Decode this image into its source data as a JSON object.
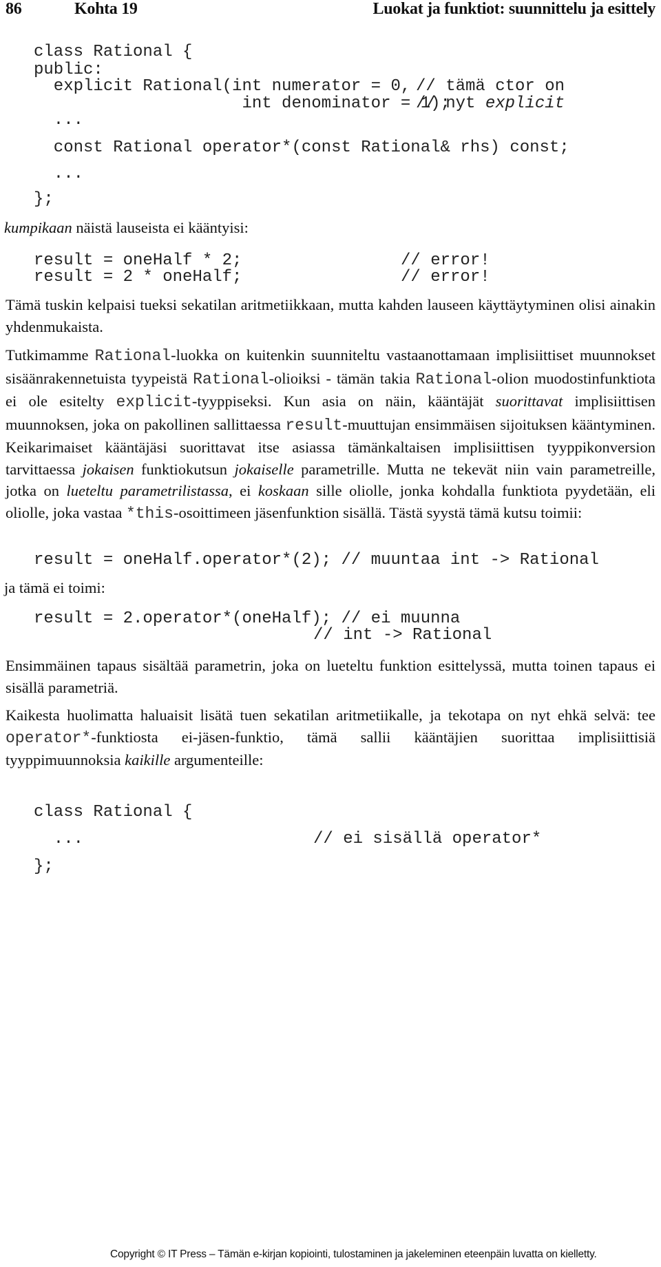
{
  "header": {
    "page_number": "86",
    "chapter": "Kohta 19",
    "section_title": "Luokat ja funktiot: suunnittelu ja esittely"
  },
  "code_block_1": {
    "lines": [
      "class Rational {",
      "public:",
      "  explicit Rational(int numerator = 0,",
      "                     int denominator = 1);",
      "  ...",
      "  const Rational operator*(const Rational& rhs) const;",
      "  ...",
      "};"
    ],
    "comment_1": "// tämä ctor on",
    "comment_2_prefix": "// nyt ",
    "comment_2_italic": "explicit"
  },
  "intro": {
    "italic": "kumpikaan",
    "rest": " näistä lauseista ei kääntyisi:"
  },
  "code_block_2": {
    "lines": [
      {
        "code": "result = oneHalf * 2;",
        "comment": "// error!"
      },
      {
        "code": "result = 2 * oneHalf;",
        "comment": "// error!"
      }
    ]
  },
  "paragraph_1": "Tämä tuskin kelpaisi tueksi sekatilan aritmetiikkaan, mutta kahden lauseen käyttäytyminen olisi ainakin yhdenmukaista.",
  "paragraph_2": {
    "segments": [
      {
        "t": "text",
        "v": "Tutkimamme "
      },
      {
        "t": "mono",
        "v": "Rational"
      },
      {
        "t": "text",
        "v": "-luokka on kuitenkin suunniteltu vastaanottamaan implisiittiset muunnokset sisäänrakennetuista tyypeistä "
      },
      {
        "t": "mono",
        "v": "Rational"
      },
      {
        "t": "text",
        "v": "-olioiksi - tämän takia "
      },
      {
        "t": "mono",
        "v": "Rational"
      },
      {
        "t": "text",
        "v": "-olion muodostinfunktiota ei ole esitelty "
      },
      {
        "t": "mono",
        "v": "explicit"
      },
      {
        "t": "text",
        "v": "-tyyppiseksi. Kun asia on näin, kääntäjät "
      },
      {
        "t": "italic",
        "v": "suorittavat"
      },
      {
        "t": "text",
        "v": " implisiittisen muunnoksen, joka on pakollinen sallittaessa "
      },
      {
        "t": "mono",
        "v": "result"
      },
      {
        "t": "text",
        "v": "-muuttujan ensimmäisen sijoituksen kääntyminen. Keikarimaiset kääntäjäsi suorittavat itse asiassa tämänkaltaisen implisiittisen tyyppikonversion tarvittaessa "
      },
      {
        "t": "italic",
        "v": "jokaisen"
      },
      {
        "t": "text",
        "v": " funktiokutsun "
      },
      {
        "t": "italic",
        "v": "jokaiselle"
      },
      {
        "t": "text",
        "v": " parametrille. Mutta ne tekevät niin vain parametreille, jotka on "
      },
      {
        "t": "italic",
        "v": "lueteltu parametrilistassa"
      },
      {
        "t": "text",
        "v": ", ei "
      },
      {
        "t": "italic",
        "v": "koskaan"
      },
      {
        "t": "text",
        "v": " sille oliolle, jonka kohdalla funktiota pyydetään, eli oliolle, joka vastaa "
      },
      {
        "t": "mono",
        "v": "*this"
      },
      {
        "t": "text",
        "v": "-osoittimeen jäsenfunktion sisällä. Tästä syystä tämä kutsu toimii:"
      }
    ]
  },
  "code_block_3": "result = oneHalf.operator*(2); // muuntaa int -> Rational",
  "transition": "ja tämä ei toimi:",
  "code_block_4": {
    "line1": "result = 2.operator*(oneHalf); // ei muunna",
    "line2": "// int -> Rational"
  },
  "paragraph_3": "Ensimmäinen tapaus sisältää parametrin, joka on lueteltu funktion esittelyssä, mutta toinen tapaus ei sisällä parametriä.",
  "paragraph_4": {
    "segments": [
      {
        "t": "text",
        "v": "Kaikesta huolimatta haluaisit lisätä tuen sekatilan aritmetiikalle, ja tekotapa on nyt ehkä selvä: tee "
      },
      {
        "t": "mono",
        "v": "operator*"
      },
      {
        "t": "text",
        "v": "-funktiosta ei-jäsen-funktio, tämä sallii kääntäjien suorittaa implisiittisiä tyyppimuunnoksia "
      },
      {
        "t": "italic",
        "v": "kaikille"
      },
      {
        "t": "text",
        "v": " argumenteille:"
      }
    ]
  },
  "code_block_5": {
    "line1": "class Rational {",
    "line2": "  ...",
    "line2_comment": "// ei sisällä operator*",
    "line3": "};"
  },
  "footer": "Copyright © IT Press – Tämän e-kirjan kopiointi, tulostaminen ja jakeleminen eteenpäin luvatta on kielletty."
}
